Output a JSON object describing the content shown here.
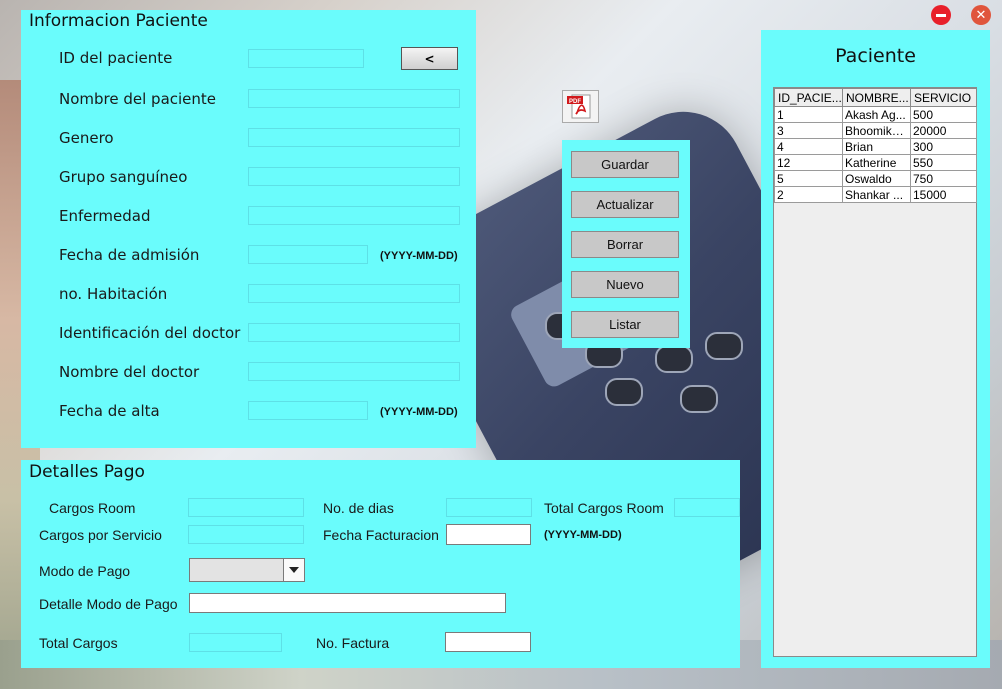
{
  "window": {
    "minimize_icon": "minus-circle-icon",
    "close_icon": "close-circle-icon",
    "minimize_color": "#e8202a",
    "close_color": "#e0553c"
  },
  "patient_panel": {
    "title": "Informacion Paciente",
    "back_label": "<",
    "fields": [
      {
        "label": "ID del paciente",
        "value": ""
      },
      {
        "label": "Nombre del paciente",
        "value": ""
      },
      {
        "label": "Genero",
        "value": ""
      },
      {
        "label": "Grupo sanguíneo",
        "value": ""
      },
      {
        "label": "Enfermedad",
        "value": ""
      },
      {
        "label": "Fecha de admisión",
        "value": "",
        "hint": "(YYYY-MM-DD)"
      },
      {
        "label": "no. Habitación",
        "value": ""
      },
      {
        "label": "Identificación del doctor",
        "value": ""
      },
      {
        "label": "Nombre del doctor",
        "value": ""
      },
      {
        "label": "Fecha de alta",
        "value": "",
        "hint": "(YYYY-MM-DD)"
      }
    ]
  },
  "pdf_button": {
    "icon": "pdf-icon",
    "badge": "PDF"
  },
  "actions": {
    "buttons": [
      "Guardar",
      "Actualizar",
      "Borrar",
      "Nuevo",
      "Listar"
    ]
  },
  "payment_panel": {
    "title": "Detalles Pago",
    "cargos_room": "Cargos Room",
    "no_dias": "No. de dias",
    "total_cargos_room": "Total Cargos Room",
    "cargos_servicio": "Cargos por Servicio",
    "fecha_facturacion": "Fecha Facturacion",
    "fecha_hint": "(YYYY-MM-DD)",
    "modo_pago": "Modo de Pago",
    "modo_pago_selected": "",
    "detalle_modo_pago": "Detalle Modo de Pago",
    "total_cargos": "Total Cargos",
    "no_factura": "No. Factura"
  },
  "list_panel": {
    "title": "Paciente",
    "columns": [
      "ID_PACIE...",
      "NOMBRE...",
      "SERVICIO"
    ],
    "rows": [
      [
        "1",
        "Akash Ag...",
        "500"
      ],
      [
        "3",
        "Bhoomika...",
        "20000"
      ],
      [
        "4",
        "Brian",
        "300"
      ],
      [
        "12",
        "Katherine",
        "550"
      ],
      [
        "5",
        "Oswaldo",
        "750"
      ],
      [
        "2",
        "Shankar ...",
        "15000"
      ]
    ]
  },
  "colors": {
    "panel": "#6afcfc",
    "button": "#c8c8c8"
  }
}
